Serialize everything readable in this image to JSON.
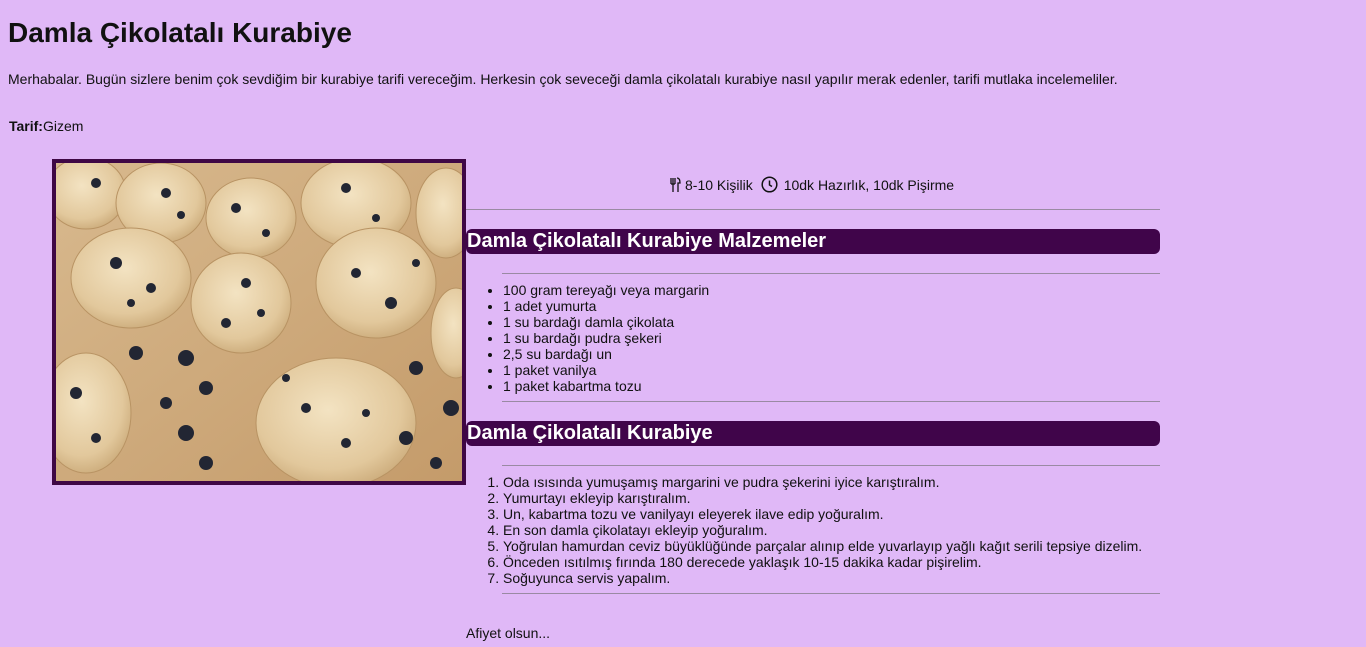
{
  "page": {
    "title": "Damla Çikolatalı Kurabiye",
    "intro": "Merhabalar. Bugün sizlere benim çok sevdiğim bir kurabiye tarifi vereceğim. Herkesin çok seveceği damla çikolatalı kurabiye nasıl yapılır merak edenler, tarifi mutlaka incelemeliler.",
    "author_label": "Tarif:",
    "author_name": "Gizem"
  },
  "meta": {
    "servings": "8-10 Kişilik",
    "time": "10dk Hazırlık, 10dk Pişirme",
    "servings_icon": "utensils-icon",
    "time_icon": "clock-icon"
  },
  "ingredients": {
    "heading": "Damla Çikolatalı Kurabiye Malzemeler",
    "items": [
      "100 gram tereyağı veya margarin",
      "1 adet yumurta",
      "1 su bardağı damla çikolata",
      "1 su bardağı pudra şekeri",
      "2,5 su bardağı un",
      "1 paket vanilya",
      "1 paket kabartma tozu"
    ]
  },
  "steps": {
    "heading": "Damla Çikolatalı Kurabiye",
    "items": [
      "Oda ısısında yumuşamış margarini ve pudra şekerini iyice karıştıralım.",
      "Yumurtayı ekleyip karıştıralım.",
      "Un, kabartma tozu ve vanilyayı eleyerek ilave edip yoğuralım.",
      "En son damla çikolatayı ekleyip yoğuralım.",
      "Yoğrulan hamurdan ceviz büyüklüğünde parçalar alınıp elde yuvarlayıp yağlı kağıt serili tepsiye dizelim.",
      "Önceden ısıtılmış fırında 180 derecede yaklaşık 10-15 dakika kadar pişirelim.",
      "Soğuyunca servis yapalım."
    ]
  },
  "closing": "Afiyet olsun...",
  "colors": {
    "background": "#e0b8f7",
    "accent": "#40054a"
  }
}
